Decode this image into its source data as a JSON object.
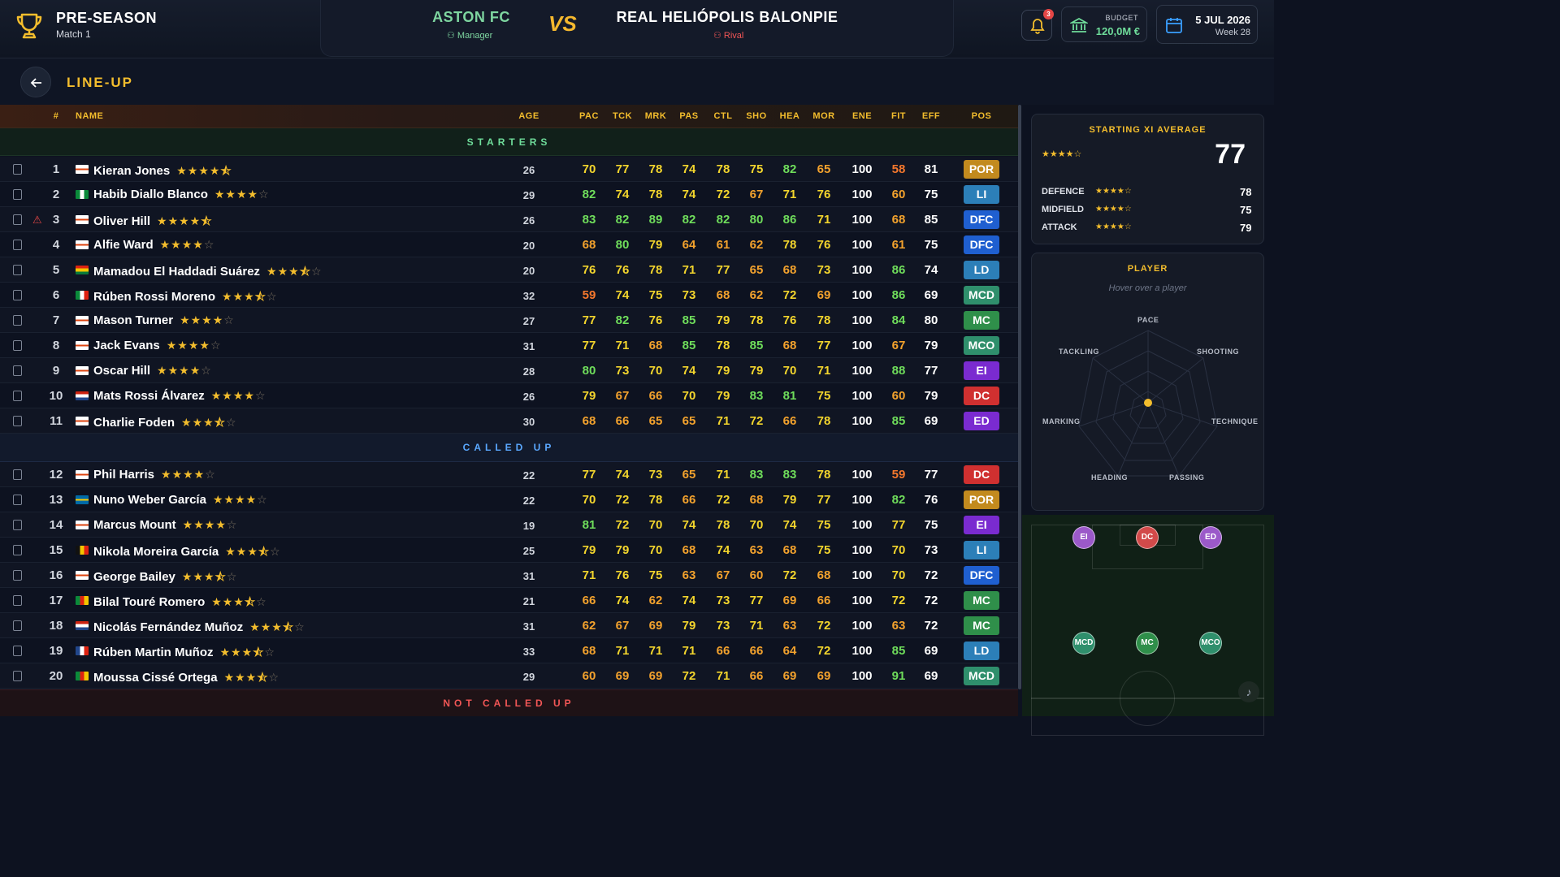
{
  "header": {
    "season": "PRE-SEASON",
    "match": "Match 1",
    "home_team": "ASTON FC",
    "home_role": "Manager",
    "vs": "VS",
    "away_team": "REAL HELIÓPOLIS BALONPIE",
    "away_role": "Rival",
    "notifications": "3",
    "budget_label": "BUDGET",
    "budget_value": "120,0M €",
    "date": "5 JUL 2026",
    "week": "Week 28"
  },
  "page": {
    "title": "LINE-UP"
  },
  "columns": {
    "num": "#",
    "name": "NAME",
    "age": "AGE",
    "stats": [
      "PAC",
      "TCK",
      "MRK",
      "PAS",
      "CTL",
      "SHO",
      "HEA",
      "MOR",
      "ENE",
      "FIT",
      "EFF"
    ],
    "pos": "POS"
  },
  "sections": {
    "starters": "STARTERS",
    "called_up": "CALLED UP",
    "not_called_up": "NOT CALLED UP"
  },
  "starters": [
    {
      "num": "1",
      "name": "Kieran Jones",
      "flag": "eng",
      "stars": 4.5,
      "age": "26",
      "stats": [
        "70",
        "77",
        "78",
        "74",
        "78",
        "75",
        "82",
        "65",
        "100",
        "58",
        "81"
      ],
      "pos": "POR",
      "warn": false
    },
    {
      "num": "2",
      "name": "Habib Diallo Blanco",
      "flag": "ng",
      "stars": 4,
      "age": "29",
      "stats": [
        "82",
        "74",
        "78",
        "74",
        "72",
        "67",
        "71",
        "76",
        "100",
        "60",
        "75"
      ],
      "pos": "LI",
      "warn": false
    },
    {
      "num": "3",
      "name": "Oliver Hill",
      "flag": "eng",
      "stars": 4.5,
      "age": "26",
      "stats": [
        "83",
        "82",
        "89",
        "82",
        "82",
        "80",
        "86",
        "71",
        "100",
        "68",
        "85"
      ],
      "pos": "DFC",
      "warn": true
    },
    {
      "num": "4",
      "name": "Alfie Ward",
      "flag": "eng",
      "stars": 4,
      "age": "20",
      "stats": [
        "68",
        "80",
        "79",
        "64",
        "61",
        "62",
        "78",
        "76",
        "100",
        "61",
        "75"
      ],
      "pos": "DFC",
      "warn": false
    },
    {
      "num": "5",
      "name": "Mamadou El Haddadi Suárez",
      "flag": "gh",
      "stars": 3.5,
      "age": "20",
      "stats": [
        "76",
        "76",
        "78",
        "71",
        "77",
        "65",
        "68",
        "73",
        "100",
        "86",
        "74"
      ],
      "pos": "LD",
      "warn": false
    },
    {
      "num": "6",
      "name": "Rúben Rossi Moreno",
      "flag": "it",
      "stars": 3.5,
      "age": "32",
      "stats": [
        "59",
        "74",
        "75",
        "73",
        "68",
        "62",
        "72",
        "69",
        "100",
        "86",
        "69"
      ],
      "pos": "MCD",
      "warn": false
    },
    {
      "num": "7",
      "name": "Mason Turner",
      "flag": "eng",
      "stars": 4,
      "age": "27",
      "stats": [
        "77",
        "82",
        "76",
        "85",
        "79",
        "78",
        "76",
        "78",
        "100",
        "84",
        "80"
      ],
      "pos": "MC",
      "warn": false
    },
    {
      "num": "8",
      "name": "Jack Evans",
      "flag": "eng",
      "stars": 4,
      "age": "31",
      "stats": [
        "77",
        "71",
        "68",
        "85",
        "78",
        "85",
        "68",
        "77",
        "100",
        "67",
        "79"
      ],
      "pos": "MCO",
      "warn": false
    },
    {
      "num": "9",
      "name": "Oscar Hill",
      "flag": "eng",
      "stars": 4,
      "age": "28",
      "stats": [
        "80",
        "73",
        "70",
        "74",
        "79",
        "79",
        "70",
        "71",
        "100",
        "88",
        "77"
      ],
      "pos": "EI",
      "warn": false
    },
    {
      "num": "10",
      "name": "Mats Rossi Álvarez",
      "flag": "nl",
      "stars": 4,
      "age": "26",
      "stats": [
        "79",
        "67",
        "66",
        "70",
        "79",
        "83",
        "81",
        "75",
        "100",
        "60",
        "79"
      ],
      "pos": "DC",
      "warn": false
    },
    {
      "num": "11",
      "name": "Charlie Foden",
      "flag": "eng",
      "stars": 3.5,
      "age": "30",
      "stats": [
        "68",
        "66",
        "65",
        "65",
        "71",
        "72",
        "66",
        "78",
        "100",
        "85",
        "69"
      ],
      "pos": "ED",
      "warn": false
    }
  ],
  "called_up": [
    {
      "num": "12",
      "name": "Phil Harris",
      "flag": "eng",
      "stars": 4,
      "age": "22",
      "stats": [
        "77",
        "74",
        "73",
        "65",
        "71",
        "83",
        "83",
        "78",
        "100",
        "59",
        "77"
      ],
      "pos": "DC"
    },
    {
      "num": "13",
      "name": "Nuno Weber García",
      "flag": "se",
      "stars": 4,
      "age": "22",
      "stats": [
        "70",
        "72",
        "78",
        "66",
        "72",
        "68",
        "79",
        "77",
        "100",
        "82",
        "76"
      ],
      "pos": "POR"
    },
    {
      "num": "14",
      "name": "Marcus Mount",
      "flag": "eng",
      "stars": 4,
      "age": "19",
      "stats": [
        "81",
        "72",
        "70",
        "74",
        "78",
        "70",
        "74",
        "75",
        "100",
        "77",
        "75"
      ],
      "pos": "EI"
    },
    {
      "num": "15",
      "name": "Nikola Moreira García",
      "flag": "be",
      "stars": 3.5,
      "age": "25",
      "stats": [
        "79",
        "79",
        "70",
        "68",
        "74",
        "63",
        "68",
        "75",
        "100",
        "70",
        "73"
      ],
      "pos": "LI"
    },
    {
      "num": "16",
      "name": "George Bailey",
      "flag": "eng",
      "stars": 3.5,
      "age": "31",
      "stats": [
        "71",
        "76",
        "75",
        "63",
        "67",
        "60",
        "72",
        "68",
        "100",
        "70",
        "72"
      ],
      "pos": "DFC"
    },
    {
      "num": "17",
      "name": "Bilal Touré Romero",
      "flag": "cm",
      "stars": 3.5,
      "age": "21",
      "stats": [
        "66",
        "74",
        "62",
        "74",
        "73",
        "77",
        "69",
        "66",
        "100",
        "72",
        "72"
      ],
      "pos": "MC"
    },
    {
      "num": "18",
      "name": "Nicolás Fernández Muñoz",
      "flag": "nl",
      "stars": 3.5,
      "age": "31",
      "stats": [
        "62",
        "67",
        "69",
        "79",
        "73",
        "71",
        "63",
        "72",
        "100",
        "63",
        "72"
      ],
      "pos": "MC"
    },
    {
      "num": "19",
      "name": "Rúben Martin Muñoz",
      "flag": "fr",
      "stars": 3.5,
      "age": "33",
      "stats": [
        "68",
        "71",
        "71",
        "71",
        "66",
        "66",
        "64",
        "72",
        "100",
        "85",
        "69"
      ],
      "pos": "LD"
    },
    {
      "num": "20",
      "name": "Moussa Cissé Ortega",
      "flag": "cm",
      "stars": 3.5,
      "age": "29",
      "stats": [
        "60",
        "69",
        "69",
        "72",
        "71",
        "66",
        "69",
        "69",
        "100",
        "91",
        "69"
      ],
      "pos": "MCD"
    }
  ],
  "average": {
    "title": "STARTING XI AVERAGE",
    "stars": 4,
    "value": "77",
    "lines": [
      {
        "label": "DEFENCE",
        "stars": 4,
        "value": "78"
      },
      {
        "label": "MIDFIELD",
        "stars": 4,
        "value": "75"
      },
      {
        "label": "ATTACK",
        "stars": 4,
        "value": "79"
      }
    ]
  },
  "player_panel": {
    "title": "PLAYER",
    "hint": "Hover over a player",
    "radar_labels": [
      "PACE",
      "SHOOTING",
      "TECHNIQUE",
      "PASSING",
      "HEADING",
      "MARKING",
      "TACKLING"
    ]
  },
  "formation": [
    {
      "pos": "EI",
      "color": "#9b59c9"
    },
    {
      "pos": "DC",
      "color": "#d24a4a"
    },
    {
      "pos": "ED",
      "color": "#9b59c9"
    },
    {
      "pos": "MCD",
      "color": "#2f8f6c"
    },
    {
      "pos": "MC",
      "color": "#2f8f4a"
    },
    {
      "pos": "MCO",
      "color": "#2f8f6c"
    }
  ],
  "pos_colors": {
    "POR": "#c28a1e",
    "LI": "#2c7fb8",
    "LD": "#2c7fb8",
    "DFC": "#1f5fd0",
    "MCD": "#2f8f6c",
    "MC": "#2f8f4a",
    "MCO": "#2f8f6c",
    "EI": "#7a2bd0",
    "ED": "#7a2bd0",
    "DC": "#d03030"
  },
  "colors": {
    "accent": "#f3bd2d",
    "home": "#7ed6a0",
    "rival": "#f25656"
  }
}
